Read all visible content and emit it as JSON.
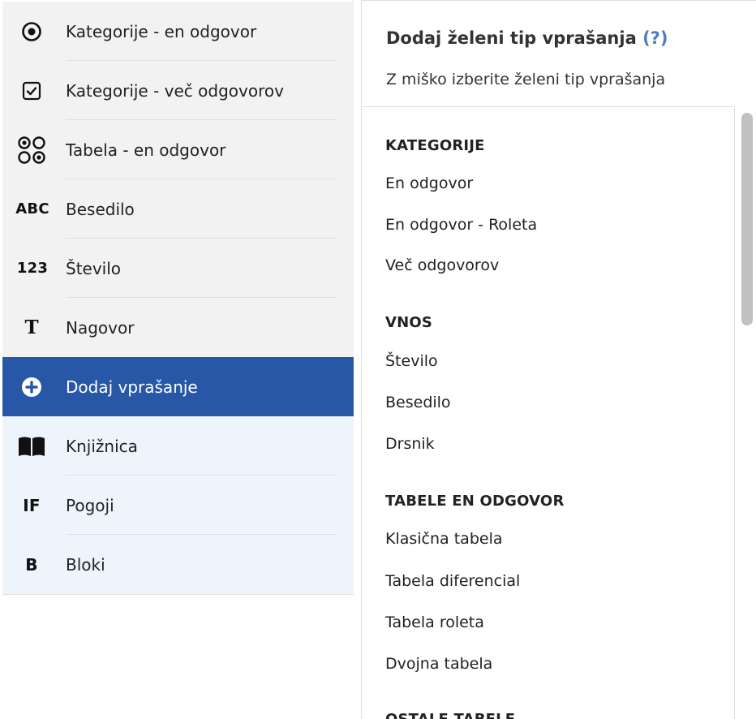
{
  "sidebar": {
    "items": [
      {
        "label": "Kategorije - en odgovor",
        "icon": "radio-button-icon"
      },
      {
        "label": "Kategorije - več odgovorov",
        "icon": "checkbox-icon"
      },
      {
        "label": "Tabela - en odgovor",
        "icon": "radio-grid-icon"
      },
      {
        "label": "Besedilo",
        "icon": "text-abc-icon",
        "icon_text": "ABC"
      },
      {
        "label": "Število",
        "icon": "number-123-icon",
        "icon_text": "123"
      },
      {
        "label": "Nagovor",
        "icon": "text-t-icon",
        "icon_text": "T"
      },
      {
        "label": "Dodaj vprašanje",
        "icon": "plus-circle-icon",
        "active": true
      },
      {
        "label": "Knjižnica",
        "icon": "book-icon"
      },
      {
        "label": "Pogoji",
        "icon": "if-icon",
        "icon_text": "IF"
      },
      {
        "label": "Bloki",
        "icon": "block-b-icon",
        "icon_text": "B"
      }
    ]
  },
  "panel": {
    "title": "Dodaj želeni tip vprašanja",
    "help_link": "(?)",
    "subtitle": "Z miško izberite želeni tip vprašanja",
    "sections": [
      {
        "title": "KATEGORIJE",
        "items": [
          "En odgovor",
          "En odgovor - Roleta",
          "Več odgovorov"
        ]
      },
      {
        "title": "VNOS",
        "items": [
          "Število",
          "Besedilo",
          "Drsnik"
        ]
      },
      {
        "title": "TABELE EN ODGOVOR",
        "items": [
          "Klasična tabela",
          "Tabela diferencial",
          "Tabela roleta",
          "Dvojna tabela"
        ]
      },
      {
        "title": "OSTALE TABELE",
        "items": []
      }
    ]
  },
  "colors": {
    "active_bg": "#2957a8",
    "sidebar_grey": "#f2f2f2",
    "sidebar_light_blue": "#edf4fc",
    "help_link": "#4a7fc1"
  }
}
